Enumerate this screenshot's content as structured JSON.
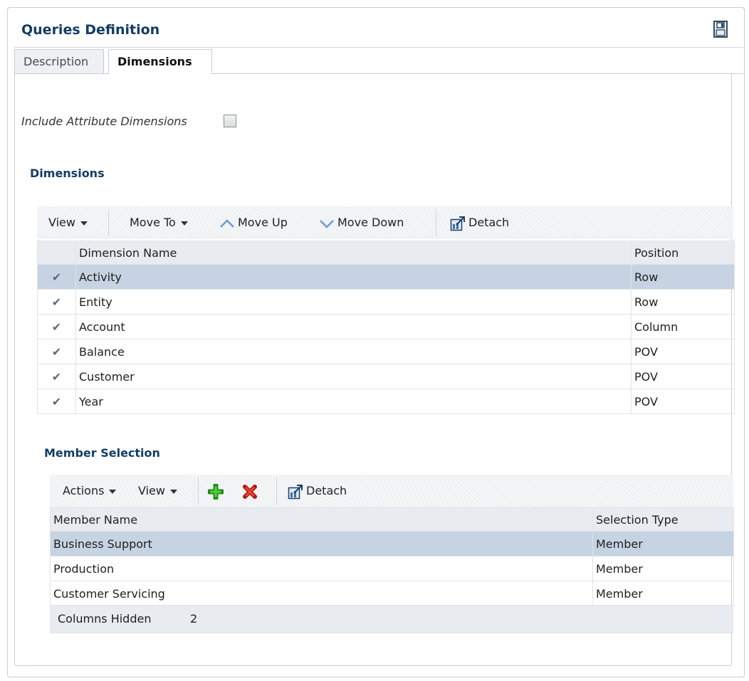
{
  "header": {
    "title": "Queries Definition",
    "save_icon": "save-icon"
  },
  "tabs": [
    {
      "label": "Description",
      "active": false
    },
    {
      "label": "Dimensions",
      "active": true
    }
  ],
  "attributes": {
    "label": "Include Attribute Dimensions",
    "checked": false
  },
  "dimensions": {
    "heading": "Dimensions",
    "toolbar": {
      "view": "View",
      "move_to": "Move To",
      "move_up": "Move Up",
      "move_down": "Move Down",
      "detach": "Detach"
    },
    "columns": [
      "Dimension Name",
      "Position"
    ],
    "rows": [
      {
        "name": "Activity",
        "position": "Row",
        "selected": true
      },
      {
        "name": "Entity",
        "position": "Row",
        "selected": false
      },
      {
        "name": "Account",
        "position": "Column",
        "selected": false
      },
      {
        "name": "Balance",
        "position": "POV",
        "selected": false
      },
      {
        "name": "Customer",
        "position": "POV",
        "selected": false
      },
      {
        "name": "Year",
        "position": "POV",
        "selected": false
      }
    ]
  },
  "member_selection": {
    "heading": "Member Selection",
    "toolbar": {
      "actions": "Actions",
      "view": "View",
      "detach": "Detach"
    },
    "columns": [
      "Member Name",
      "Selection Type"
    ],
    "rows": [
      {
        "name": "Business Support",
        "type": "Member",
        "selected": true
      },
      {
        "name": "Production",
        "type": "Member",
        "selected": false
      },
      {
        "name": "Customer Servicing",
        "type": "Member",
        "selected": false
      }
    ],
    "footer": {
      "label": "Columns Hidden",
      "count": "2"
    }
  },
  "colors": {
    "heading": "#123d64",
    "selected_row": "#c6d3e2",
    "add_icon": "#2eaa22",
    "delete_icon": "#d9251c"
  }
}
